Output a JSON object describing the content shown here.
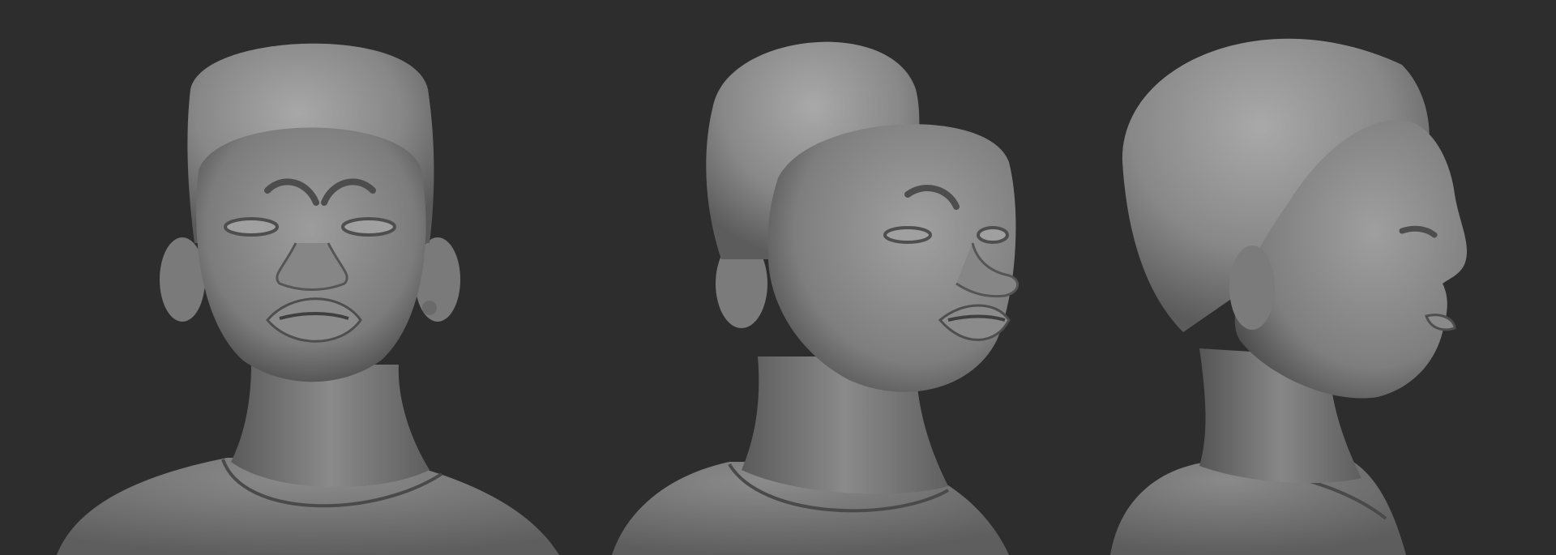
{
  "scene": {
    "background_color": "#2d2d2d",
    "clay_color": "#8f8f8f",
    "views": [
      {
        "id": "front",
        "label": ""
      },
      {
        "id": "three-quarter",
        "label": ""
      },
      {
        "id": "profile",
        "label": ""
      }
    ]
  }
}
